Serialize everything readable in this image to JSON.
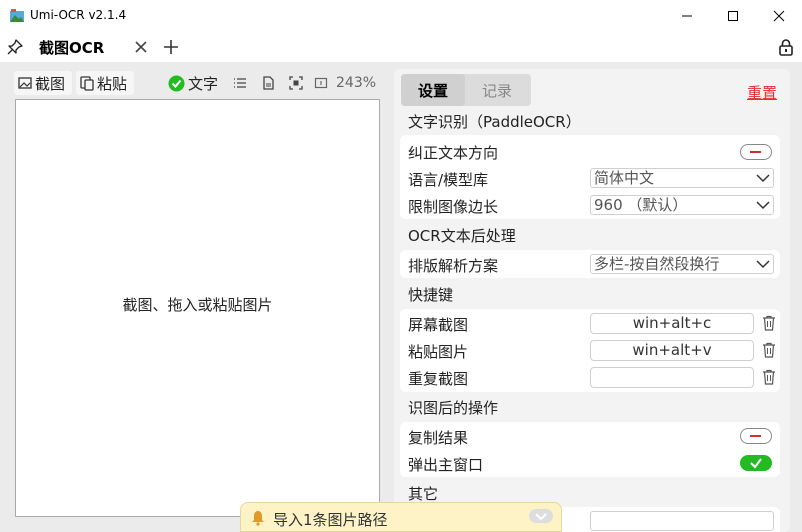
{
  "window": {
    "title": "Umi-OCR v2.1.4"
  },
  "tabs": [
    {
      "label": "截图OCR"
    }
  ],
  "left_toolbar": {
    "screenshot_label": "截图",
    "paste_label": "粘贴",
    "text_label": "文字",
    "zoom": "243%"
  },
  "canvas": {
    "hint": "截图、拖入或粘贴图片"
  },
  "right_tabs": {
    "settings": "设置",
    "records": "记录",
    "reset": "重置"
  },
  "sections": {
    "ocr": {
      "title": "文字识别（PaddleOCR）",
      "correct_direction": "纠正文本方向",
      "language_label": "语言/模型库",
      "language_value": "简体中文",
      "limit_label": "限制图像边长",
      "limit_value": "960 （默认）"
    },
    "post": {
      "title": "OCR文本后处理",
      "layout_label": "排版解析方案",
      "layout_value": "多栏-按自然段换行"
    },
    "hotkeys": {
      "title": "快捷键",
      "screenshot_label": "屏幕截图",
      "screenshot_value": "win+alt+c",
      "paste_label": "粘贴图片",
      "paste_value": "win+alt+v",
      "repeat_label": "重复截图",
      "repeat_value": ""
    },
    "after": {
      "title": "识图后的操作",
      "copy_label": "复制结果",
      "popup_label": "弹出主窗口"
    },
    "other": {
      "title": "其它"
    }
  },
  "toast": {
    "text": "导入1条图片路径"
  },
  "toggles": {
    "correct_direction": false,
    "copy_result": false,
    "popup_main_window": true
  },
  "colors": {
    "accent_green": "#22bb22",
    "reset_red": "#e23030",
    "toast_bg": "#fdf3c7"
  }
}
